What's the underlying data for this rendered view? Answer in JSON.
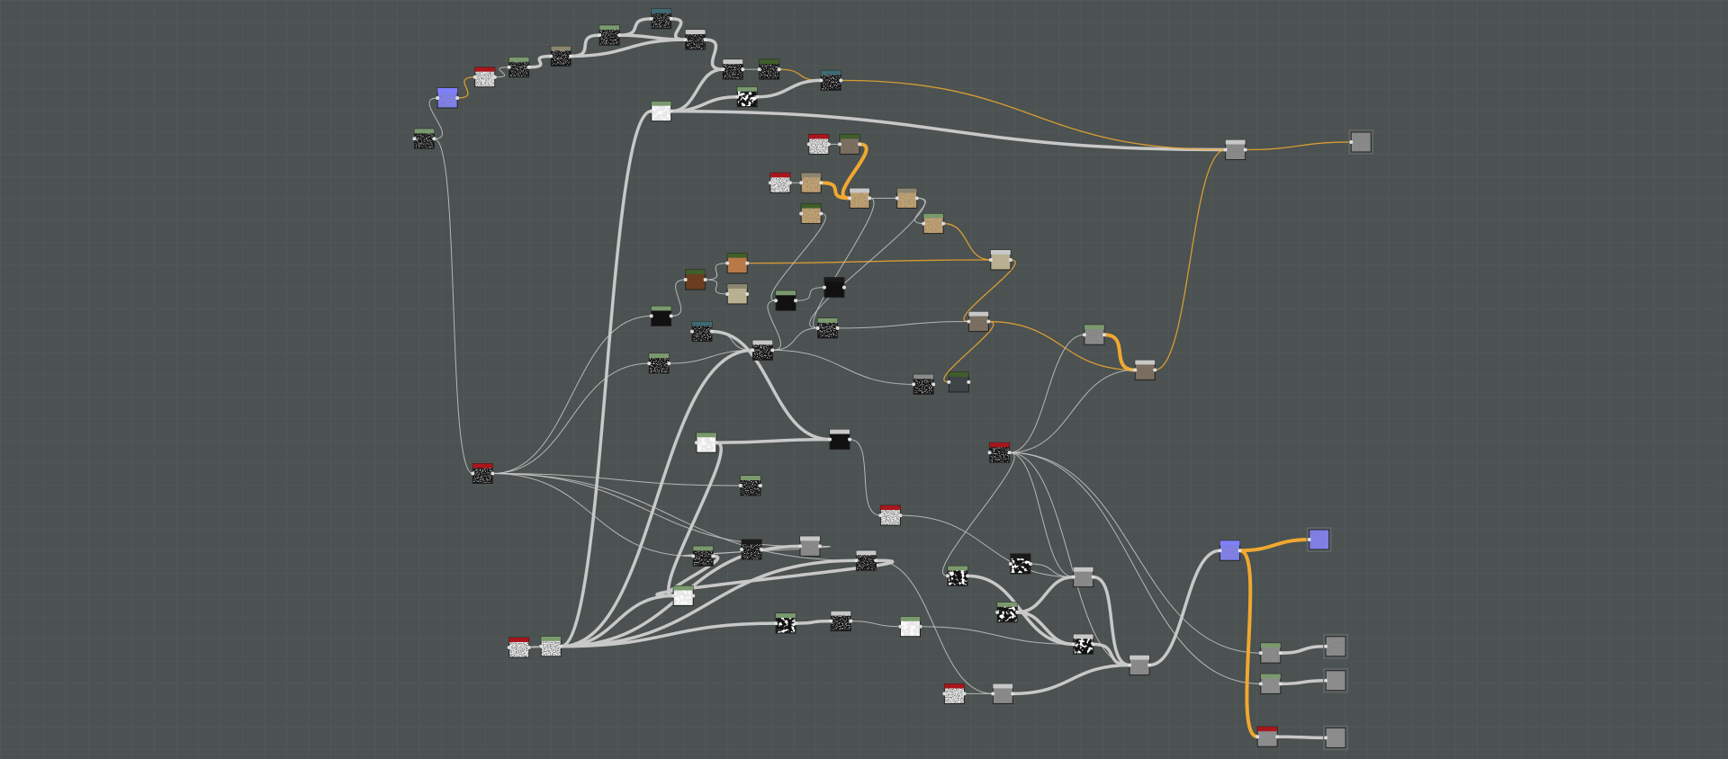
{
  "graph_editor": {
    "background_color": "#4b5251",
    "grid_color": "#555c5b",
    "wire_colors": {
      "gray": "#c8c8c8",
      "orange": "#f0a830"
    },
    "header_colors": {
      "green": "#7a9a6e",
      "dark_green": "#3f5e2a",
      "red": "#a8161c",
      "tan": "#8a8670",
      "teal": "#3e6a72",
      "white": "#c8c8c8",
      "black": "#1a1a1a",
      "gray": "#8a8a8a",
      "blue": "#7f7fff",
      "brown": "#5a3a1a"
    },
    "thumbnail_colors": {
      "normal": "#8080ff",
      "tan": "#c8a46e",
      "brown": "#b87848",
      "light_tan": "#b8b090",
      "dark_brown": "#6a3e1e",
      "slate": "#3e4448",
      "gray": "#8c8c8c"
    }
  }
}
